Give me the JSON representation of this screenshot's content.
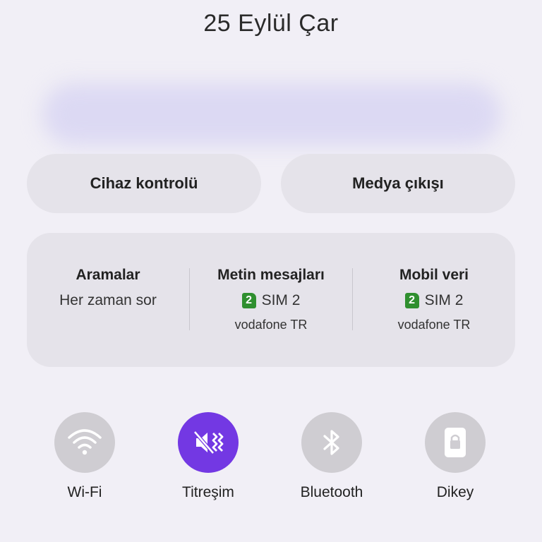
{
  "header": {
    "date": "25 Eylül Çar"
  },
  "buttons": {
    "device_control": "Cihaz kontrolü",
    "media_output": "Medya çıkışı"
  },
  "sim_panel": {
    "calls": {
      "title": "Aramalar",
      "value": "Her zaman sor"
    },
    "messages": {
      "title": "Metin mesajları",
      "sim_number": "2",
      "sim_label": "SIM 2",
      "carrier": "vodafone TR"
    },
    "mobile_data": {
      "title": "Mobil veri",
      "sim_number": "2",
      "sim_label": "SIM 2",
      "carrier": "vodafone TR"
    }
  },
  "quick_tiles": [
    {
      "label": "Wi-Fi",
      "icon": "wifi-icon",
      "active": false
    },
    {
      "label": "Titreşim",
      "icon": "vibrate-icon",
      "active": true
    },
    {
      "label": "Bluetooth",
      "icon": "bluetooth-icon",
      "active": false
    },
    {
      "label": "Dikey",
      "icon": "portrait-lock-icon",
      "active": false
    }
  ],
  "colors": {
    "accent": "#7338e3",
    "sim_badge": "#2f8f2f",
    "inactive_tile": "#cfcdd2",
    "panel_bg": "#e5e3ea",
    "page_bg": "#f1eff6"
  }
}
